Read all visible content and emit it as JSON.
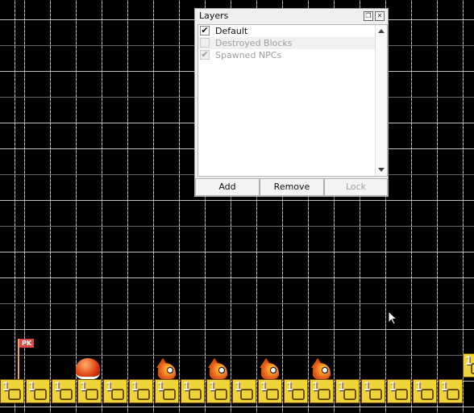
{
  "panel": {
    "title": "Layers",
    "layers": [
      {
        "name": "Default",
        "checked": true,
        "enabled": true
      },
      {
        "name": "Destroyed Blocks",
        "checked": false,
        "enabled": false
      },
      {
        "name": "Spawned NPCs",
        "checked": true,
        "enabled": false
      }
    ],
    "buttons": {
      "add": "Add",
      "remove": "Remove",
      "lock": "Lock"
    },
    "float_icon": "restore-icon",
    "close_icon": "close-icon"
  },
  "scene": {
    "block_label": "1",
    "flag_text": "PK",
    "icons": [
      "flag-icon",
      "shell-icon",
      "fire-enemy-icon",
      "mouse-cursor-icon"
    ]
  }
}
